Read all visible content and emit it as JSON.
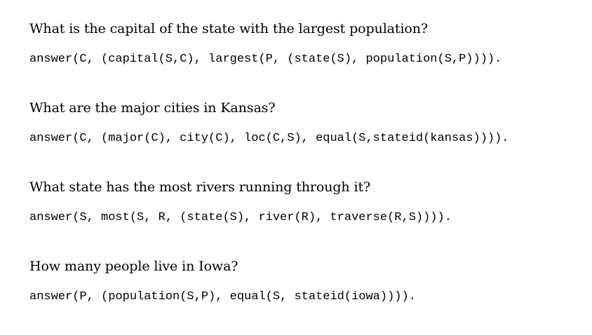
{
  "examples": [
    {
      "question": "What is the capital of the state with the largest population?",
      "query": "answer(C, (capital(S,C), largest(P, (state(S), population(S,P))))."
    },
    {
      "question": "What are the major cities in Kansas?",
      "query": "answer(C, (major(C), city(C), loc(C,S), equal(S,stateid(kansas))))."
    },
    {
      "question": "What state has the most rivers running through it?",
      "query": "answer(S, most(S, R, (state(S), river(R), traverse(R,S))))."
    },
    {
      "question": "How many people live in Iowa?",
      "query": "answer(P, (population(S,P), equal(S, stateid(iowa))))."
    }
  ]
}
